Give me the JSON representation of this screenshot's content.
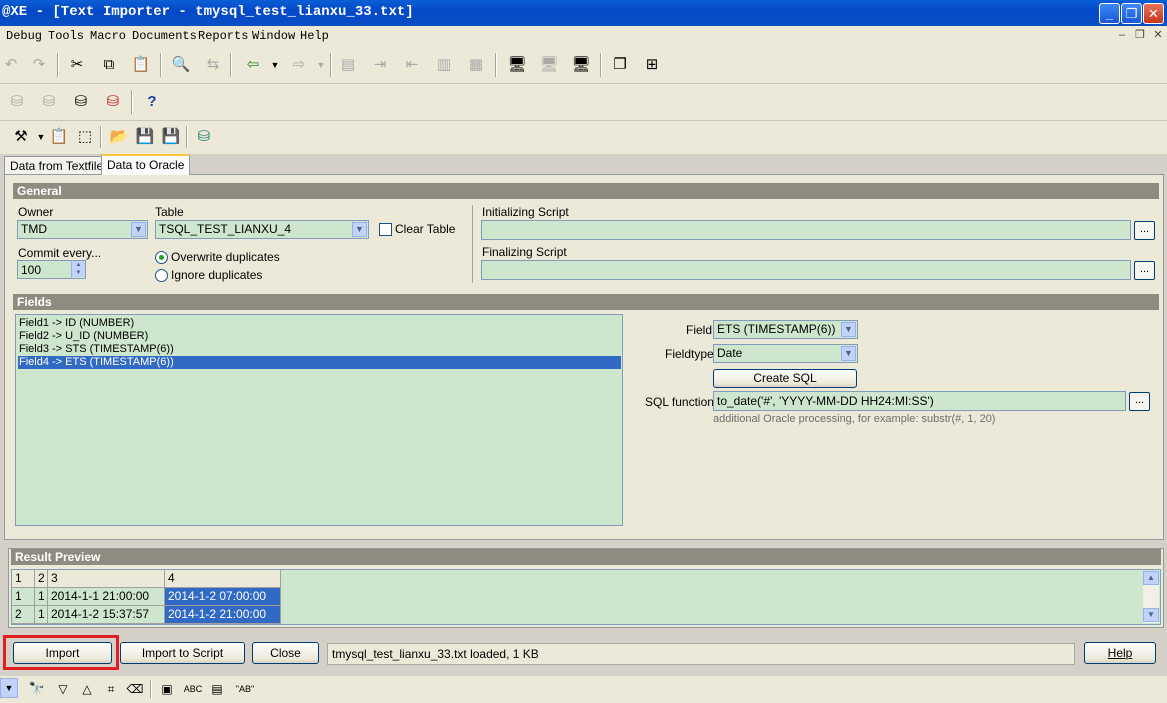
{
  "title_bar": {
    "title": "@XE - [Text Importer - tmysql_test_lianxu_33.txt]",
    "minimize": "_",
    "restore": "❐",
    "close": "✕"
  },
  "menu": {
    "items": [
      "Debug",
      "Tools",
      "Macro",
      "Documents",
      "Reports",
      "Window",
      "Help"
    ],
    "mdi_minimize": "–",
    "mdi_restore": "❐",
    "mdi_close": "✕"
  },
  "tabs": [
    "Data from Textfile",
    "Data to Oracle"
  ],
  "active_tab": "Data to Oracle",
  "general": {
    "header": "General",
    "owner_label": "Owner",
    "owner_value": "TMD",
    "table_label": "Table",
    "table_value": "TSQL_TEST_LIANXU_4",
    "clear_table_label": "Clear Table",
    "commit_label": "Commit every...",
    "commit_value": "100",
    "overwrite_label": "Overwrite duplicates",
    "ignore_label": "Ignore duplicates",
    "init_script_label": "Initializing Script",
    "init_script_value": "",
    "final_script_label": "Finalizing Script",
    "final_script_value": "",
    "dots": "..."
  },
  "fields": {
    "header": "Fields",
    "list": [
      "Field1  ->  ID (NUMBER)",
      "Field2  ->  U_ID (NUMBER)",
      "Field3  ->  STS (TIMESTAMP(6))",
      "Field4  ->  ETS (TIMESTAMP(6))"
    ],
    "selected_index": 3,
    "field_label": "Field",
    "field_value": "ETS (TIMESTAMP(6))",
    "fieldtype_label": "Fieldtype",
    "fieldtype_value": "Date",
    "create_sql_label": "Create SQL",
    "sql_function_label": "SQL function",
    "sql_function_value": "to_date('#', 'YYYY-MM-DD HH24:MI:SS')",
    "hint": "additional Oracle processing, for example: substr(#, 1, 20)"
  },
  "result": {
    "header": "Result Preview",
    "columns": [
      "1",
      "2",
      "3",
      "4"
    ],
    "rows": [
      [
        "1",
        "1",
        "2014-1-1 21:00:00",
        "2014-1-2 07:00:00"
      ],
      [
        "2",
        "1",
        "2014-1-2 15:37:57",
        "2014-1-2 21:00:00"
      ]
    ]
  },
  "buttons": {
    "import": "Import",
    "import_to_script": "Import to Script",
    "close": "Close",
    "help": "Help"
  },
  "status_text": "tmysql_test_lianxu_33.txt loaded,  1 KB",
  "bottom_toolbar": {
    "abc_label": "ABC",
    "ab_quote_label": "\"AB\""
  },
  "colors": {
    "accent_highlight": "#e02020",
    "field_bg": "#cde6cd",
    "selection": "#316ac5"
  }
}
